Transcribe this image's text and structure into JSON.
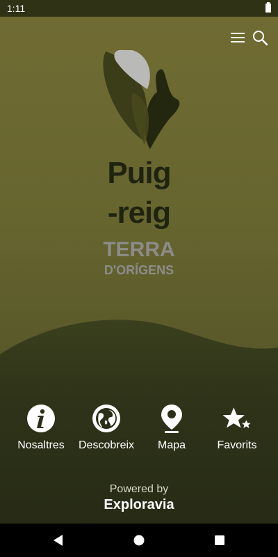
{
  "status": {
    "time": "1:11",
    "battery_icon": "battery-icon"
  },
  "header": {
    "menu_icon": "menu-icon",
    "search_icon": "search-icon"
  },
  "logo": {
    "line1": "Puig",
    "line2": "-reig",
    "line3": "TERRA",
    "line4": "D'ORÍGENS"
  },
  "nav": [
    {
      "label": "Nosaltres",
      "icon": "info-icon"
    },
    {
      "label": "Descobreix",
      "icon": "globe-icon"
    },
    {
      "label": "Mapa",
      "icon": "map-pin-icon"
    },
    {
      "label": "Favorits",
      "icon": "star-icon"
    }
  ],
  "footer": {
    "powered_by": "Powered by",
    "brand": "Exploravia"
  },
  "colors": {
    "olive": "#67652f",
    "dark_olive": "#2c3017",
    "text_dark": "#1f2410",
    "grey_text": "#8c8c8a"
  }
}
